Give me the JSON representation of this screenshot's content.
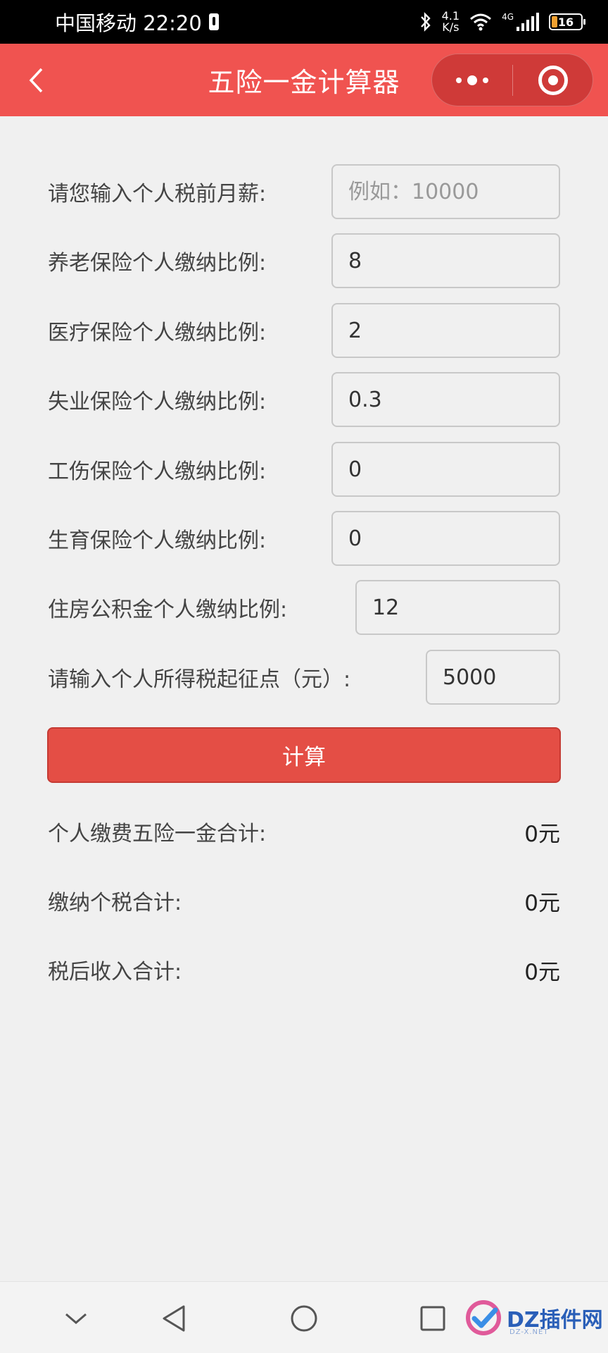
{
  "status_bar": {
    "carrier_time": "中国移动 22:20",
    "speed_value": "4.1",
    "speed_unit": "K/s",
    "network": "4G",
    "battery": "16"
  },
  "nav": {
    "title": "五险一金计算器"
  },
  "form": {
    "fields": [
      {
        "label": "请您输入个人税前月薪:",
        "value": "",
        "placeholder": "例如：10000"
      },
      {
        "label": "养老保险个人缴纳比例:",
        "value": "8",
        "placeholder": ""
      },
      {
        "label": "医疗保险个人缴纳比例:",
        "value": "2",
        "placeholder": ""
      },
      {
        "label": "失业保险个人缴纳比例:",
        "value": "0.3",
        "placeholder": ""
      },
      {
        "label": "工伤保险个人缴纳比例:",
        "value": "0",
        "placeholder": ""
      },
      {
        "label": "生育保险个人缴纳比例:",
        "value": "0",
        "placeholder": ""
      },
      {
        "label": "住房公积金个人缴纳比例:",
        "value": "12",
        "placeholder": ""
      },
      {
        "label": "请输入个人所得税起征点（元）:",
        "value": "5000",
        "placeholder": ""
      }
    ],
    "calculate_label": "计算"
  },
  "results": [
    {
      "label": "个人缴费五险一金合计:",
      "value": "0元"
    },
    {
      "label": "缴纳个税合计:",
      "value": "0元"
    },
    {
      "label": "税后收入合计:",
      "value": "0元"
    }
  ],
  "watermark": {
    "text": "DZ插件网",
    "sub": "DZ-X.NET"
  },
  "colors": {
    "accent": "#f05350",
    "button": "#e44e45",
    "capsule": "#cf3a38",
    "background": "#f0f0f0"
  }
}
